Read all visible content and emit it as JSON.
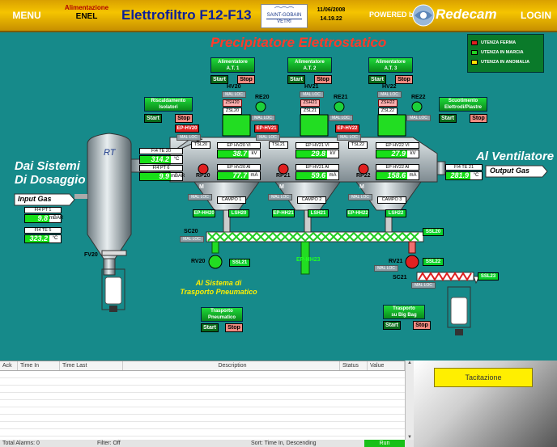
{
  "topbar": {
    "menu": "MENU",
    "alim_line1": "Alimentazione",
    "alim_line2": "ENEL",
    "title": "Elettrofiltro F12-F13",
    "logo_line1": "SAINT-GOBAIN",
    "logo_line2": "VETRI",
    "date": "11/06/2008",
    "time": "14.19.22",
    "powered": "POWERED by",
    "brand": "Redecam",
    "login": "LOGIN"
  },
  "headline": "Precipitatore Elettrostatico",
  "legend": [
    {
      "label": "UTENZA FERMA",
      "color": "#e02020"
    },
    {
      "label": "UTENZA IN MARCIA",
      "color": "#22d022"
    },
    {
      "label": "UTENZA IN ANOMALIA",
      "color": "#ffe000"
    }
  ],
  "alimentatori": [
    {
      "l1": "Alimentatore",
      "l2": "A.T. 1",
      "start": "Start",
      "stop": "Stop"
    },
    {
      "l1": "Alimentatore",
      "l2": "A.T. 2",
      "start": "Start",
      "stop": "Stop"
    },
    {
      "l1": "Alimentatore",
      "l2": "A.T. 3",
      "start": "Start",
      "stop": "Stop"
    }
  ],
  "riscaldamento": {
    "l1": "Riscaldamento",
    "l2": "Isolatori",
    "start": "Start",
    "stop": "Stop"
  },
  "scuotimento": {
    "l1": "Scuotimento",
    "l2": "Elettrodi/Piastre",
    "start": "Start",
    "stop": "Stop"
  },
  "fields": [
    {
      "hv": "HV20",
      "re": "RE20",
      "rp": "RP20",
      "mal": "MAL LOC",
      "zsh": "ZSH20",
      "zsl": "ZSL20",
      "ephv": "EP-HV20",
      "tsl": "TSL20",
      "vi_label": "EP HV20 VI",
      "vi": "38.7",
      "vi_unit": "kV",
      "ai_label": "EP HV20 AI",
      "ai": "77.7",
      "ai_unit": "mA",
      "campo": "CAMPO 1",
      "ephh": "EP-HH20",
      "lsh": "LSH20"
    },
    {
      "hv": "HV21",
      "re": "RE21",
      "rp": "RP21",
      "mal": "MAL LOC",
      "zsh": "ZSH21",
      "zsl": "ZSL21",
      "ephv": "EP-HV21",
      "tsl": "TSL21",
      "vi_label": "EP HV21 VI",
      "vi": "29.8",
      "vi_unit": "kV",
      "ai_label": "EP HV21 AI",
      "ai": "59.6",
      "ai_unit": "mA",
      "campo": "CAMPO 2",
      "ephh": "EP-HH21",
      "lsh": "LSH21"
    },
    {
      "hv": "HV22",
      "re": "RE22",
      "rp": "RP22",
      "mal": "MAL LOC",
      "zsh": "ZSH22",
      "zsl": "ZSL22",
      "ephv": "EP-HV22",
      "tsl": "TSL22",
      "vi_label": "EP HV22 VI",
      "vi": "27.9",
      "vi_unit": "kV",
      "ai_label": "EP HV22 AI",
      "ai": "158.6",
      "ai_unit": "mA",
      "campo": "CAMPO 3",
      "ephh": "EP-HH22",
      "lsh": "LSH22"
    }
  ],
  "left": {
    "title1": "Dai Sistemi",
    "title2": "Di Dosaggio",
    "input": "Input Gas",
    "pt1_label": "FI4 PT 1",
    "pt1": "9.8",
    "pt1_unit": "mBAR",
    "te5_label": "FI4 TE 5",
    "te5": "323.2",
    "te5_unit": "°C",
    "rt": "RT",
    "te20_label": "FI4 TE 20",
    "te20": "314.2",
    "te20_unit": "°C",
    "pt6_label": "FI4 PT 6",
    "pt6": "9.9",
    "pt6_unit": "mBAR",
    "fv": "FV20"
  },
  "right": {
    "title": "Al Ventilatore",
    "output": "Output Gas",
    "te21_label": "FI4 TE 21",
    "te21": "281.9",
    "te21_unit": "°C"
  },
  "bottom": {
    "sc20": "SC20",
    "sc20_mal": "MAL LOC",
    "ssl20": "SSL20",
    "rv20": "RV20",
    "ssl21": "SSL21",
    "ephh23": "EP-HH23",
    "rv21": "RV21",
    "ssl22": "SSL22",
    "rv21_mal": "MAL LOC",
    "sc21": "SC21",
    "ssl23": "SSL23",
    "sc21_mal": "MAL LOC",
    "pneum_title1": "Al Sistema di",
    "pneum_title2": "Trasporto Pneumatico",
    "pneum_btn1": "Trasporto",
    "pneum_btn2": "Pneumatico",
    "pneum_start": "Start",
    "pneum_stop": "Stop",
    "bigbag_btn1": "Trasporto",
    "bigbag_btn2": "su Big Bag",
    "bigbag_start": "Start",
    "bigbag_stop": "Stop"
  },
  "alarms": {
    "columns": [
      "Ack",
      "Time In",
      "Time Last",
      "Description",
      "Status",
      "Value"
    ],
    "footer_total": "Total Alarms: 0",
    "footer_filter": "Filter: Off",
    "footer_sort": "Sort: Time In, Descending",
    "footer_run": "Run"
  },
  "tacitazione": "Tacitazione"
}
